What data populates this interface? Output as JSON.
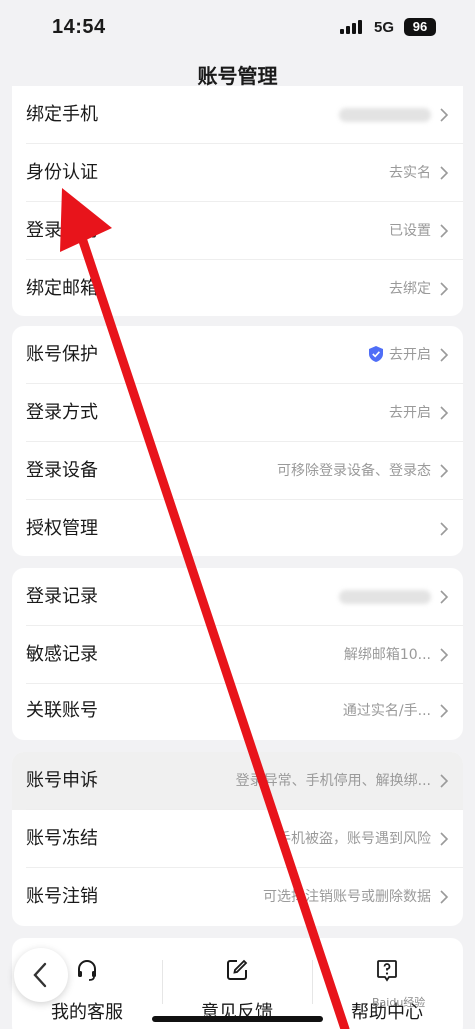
{
  "status_bar": {
    "time": "14:54",
    "network": "5G",
    "battery": "96"
  },
  "header": {
    "title": "账号管理"
  },
  "sections": [
    {
      "rows": [
        {
          "label": "绑定手机",
          "value": "",
          "blurred": true
        },
        {
          "label": "身份认证",
          "value": "去实名"
        },
        {
          "label": "登录密码",
          "value": "已设置"
        },
        {
          "label": "绑定邮箱",
          "value": "去绑定"
        }
      ]
    },
    {
      "rows": [
        {
          "label": "账号保护",
          "value": "去开启",
          "icon": "shield-check-icon"
        },
        {
          "label": "登录方式",
          "value": "去开启"
        },
        {
          "label": "登录设备",
          "value": "可移除登录设备、登录态"
        },
        {
          "label": "授权管理",
          "value": ""
        }
      ]
    },
    {
      "rows": [
        {
          "label": "登录记录",
          "value": "",
          "blurred": true
        },
        {
          "label": "敏感记录",
          "value": "解绑邮箱10..."
        },
        {
          "label": "关联账号",
          "value": "通过实名/手..."
        }
      ]
    },
    {
      "rows": [
        {
          "label": "账号申诉",
          "value": "登录异常、手机停用、解换绑..."
        },
        {
          "label": "账号冻结",
          "value": "手机被盗，账号遇到风险"
        },
        {
          "label": "账号注销",
          "value": "可选择注销账号或删除数据"
        }
      ]
    }
  ],
  "bottom_tabs": [
    {
      "label": "我的客服",
      "icon": "headset-icon"
    },
    {
      "label": "意见反馈",
      "icon": "edit-icon"
    },
    {
      "label": "帮助中心",
      "icon": "help-icon"
    }
  ],
  "watermark": "Baidu经验",
  "colors": {
    "accent_shield": "#4f6ef7",
    "annotation_arrow": "#e8141b",
    "background": "#f2f2f4"
  }
}
